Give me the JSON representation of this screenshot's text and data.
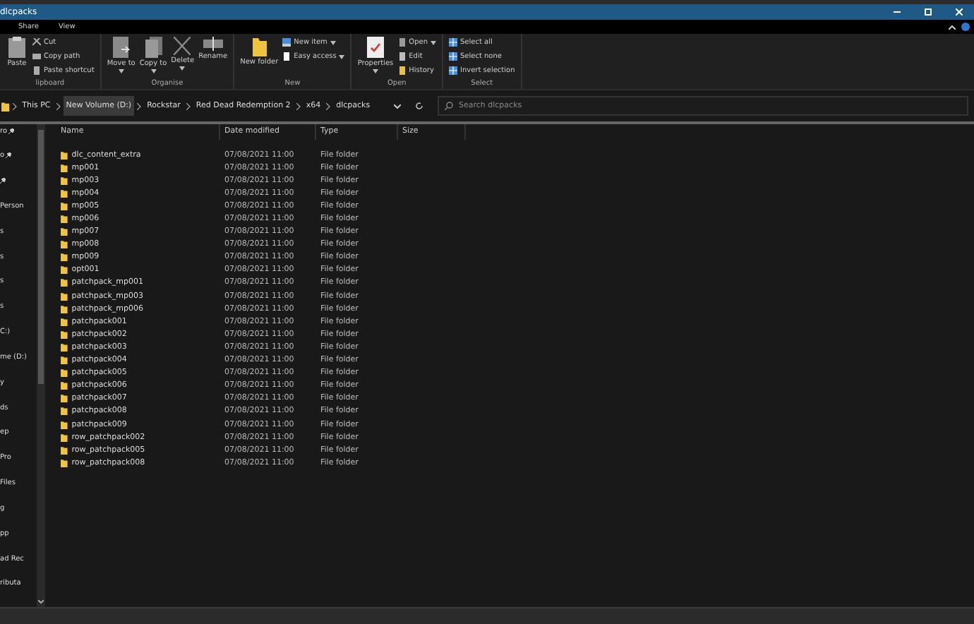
{
  "window": {
    "title": "dlcpacks"
  },
  "menu_tabs": [
    {
      "label": "Share",
      "selected": false
    },
    {
      "label": "View",
      "selected": false
    }
  ],
  "ribbon": {
    "groups": [
      {
        "label": "lipboard",
        "big": [
          {
            "label": "Paste",
            "caret": false
          }
        ],
        "small": [
          {
            "label": "Cut",
            "caret": false
          },
          {
            "label": "Copy path",
            "caret": false
          },
          {
            "label": "Paste shortcut",
            "caret": false
          }
        ]
      },
      {
        "label": "Organise",
        "big": [
          {
            "label": "Move to",
            "caret": true
          },
          {
            "label": "Copy to",
            "caret": true
          },
          {
            "label": "Delete",
            "caret": true
          },
          {
            "label": "Rename",
            "caret": false
          }
        ]
      },
      {
        "label": "New",
        "big": [
          {
            "label": "New folder",
            "caret": false
          }
        ],
        "small": [
          {
            "label": "New item",
            "caret": true
          },
          {
            "label": "Easy access",
            "caret": true
          }
        ]
      },
      {
        "label": "Open",
        "big": [
          {
            "label": "Properties",
            "caret": true
          }
        ],
        "small": [
          {
            "label": "Open",
            "caret": true
          },
          {
            "label": "Edit",
            "caret": false
          },
          {
            "label": "History",
            "caret": false
          }
        ]
      },
      {
        "label": "Select",
        "small": [
          {
            "label": "Select all",
            "caret": false
          },
          {
            "label": "Select none",
            "caret": false
          },
          {
            "label": "Invert selection",
            "caret": false
          }
        ]
      }
    ]
  },
  "address": {
    "crumbs": [
      {
        "label": "This PC",
        "selected": false
      },
      {
        "label": "New Volume (D:)",
        "selected": true
      },
      {
        "label": "Rockstar",
        "selected": false
      },
      {
        "label": "Red Dead Redemption 2",
        "selected": false
      },
      {
        "label": "x64",
        "selected": false
      },
      {
        "label": "dlcpacks",
        "selected": false
      }
    ],
    "search_placeholder": "Search dlcpacks"
  },
  "sidebar": {
    "items": [
      {
        "label": "ro",
        "pinned": true
      },
      {
        "label": "o",
        "pinned": true
      },
      {
        "pinned": true
      },
      {
        "label": "Person",
        "pinned": false
      },
      {
        "label": "s",
        "pinned": false
      },
      {
        "label": "s",
        "pinned": false
      },
      {
        "label": "s",
        "pinned": false
      },
      {
        "label": "s",
        "pinned": false
      },
      {
        "label": "C:)",
        "pinned": false
      },
      {
        "label": "me (D:)",
        "pinned": false
      },
      {
        "label": "y",
        "pinned": false
      },
      {
        "label": "ds",
        "pinned": false
      },
      {
        "label": "ep",
        "pinned": false
      },
      {
        "label": "Pro",
        "pinned": false
      },
      {
        "label": "Files",
        "pinned": false
      },
      {
        "label": "g",
        "pinned": false
      },
      {
        "label": "pp",
        "pinned": false
      },
      {
        "label": "ad Rec",
        "pinned": false
      },
      {
        "label": "ributa",
        "pinned": false
      }
    ]
  },
  "table": {
    "columns": [
      "Name",
      "Date modified",
      "Type",
      "Size"
    ],
    "rows": [
      {
        "name": "dlc_content_extra",
        "date": "07/08/2021 11:00",
        "type": "File folder"
      },
      {
        "name": "mp001",
        "date": "07/08/2021 11:00",
        "type": "File folder"
      },
      {
        "name": "mp003",
        "date": "07/08/2021 11:00",
        "type": "File folder"
      },
      {
        "name": "mp004",
        "date": "07/08/2021 11:00",
        "type": "File folder"
      },
      {
        "name": "mp005",
        "date": "07/08/2021 11:00",
        "type": "File folder"
      },
      {
        "name": "mp006",
        "date": "07/08/2021 11:00",
        "type": "File folder"
      },
      {
        "name": "mp007",
        "date": "07/08/2021 11:00",
        "type": "File folder"
      },
      {
        "name": "mp008",
        "date": "07/08/2021 11:00",
        "type": "File folder"
      },
      {
        "name": "mp009",
        "date": "07/08/2021 11:00",
        "type": "File folder"
      },
      {
        "name": "opt001",
        "date": "07/08/2021 11:00",
        "type": "File folder"
      },
      {
        "name": "patchpack_mp001",
        "date": "07/08/2021 11:00",
        "type": "File folder"
      },
      {
        "name": "patchpack_mp003",
        "date": "07/08/2021 11:00",
        "type": "File folder"
      },
      {
        "name": "patchpack_mp006",
        "date": "07/08/2021 11:00",
        "type": "File folder"
      },
      {
        "name": "patchpack001",
        "date": "07/08/2021 11:00",
        "type": "File folder"
      },
      {
        "name": "patchpack002",
        "date": "07/08/2021 11:00",
        "type": "File folder"
      },
      {
        "name": "patchpack003",
        "date": "07/08/2021 11:00",
        "type": "File folder"
      },
      {
        "name": "patchpack004",
        "date": "07/08/2021 11:00",
        "type": "File folder"
      },
      {
        "name": "patchpack005",
        "date": "07/08/2021 11:00",
        "type": "File folder"
      },
      {
        "name": "patchpack006",
        "date": "07/08/2021 11:00",
        "type": "File folder"
      },
      {
        "name": "patchpack007",
        "date": "07/08/2021 11:00",
        "type": "File folder"
      },
      {
        "name": "patchpack008",
        "date": "07/08/2021 11:00",
        "type": "File folder"
      },
      {
        "name": "patchpack009",
        "date": "07/08/2021 11:00",
        "type": "File folder"
      },
      {
        "name": "row_patchpack002",
        "date": "07/08/2021 11:00",
        "type": "File folder"
      },
      {
        "name": "row_patchpack005",
        "date": "07/08/2021 11:00",
        "type": "File folder"
      },
      {
        "name": "row_patchpack008",
        "date": "07/08/2021 11:00",
        "type": "File folder"
      }
    ]
  }
}
